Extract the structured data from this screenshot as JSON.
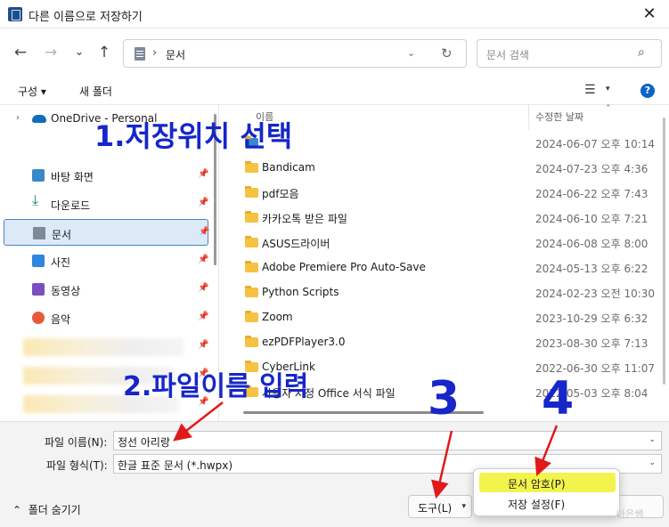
{
  "window": {
    "title": "다른 이름으로 저장하기",
    "close": "✕"
  },
  "nav": {
    "back": "←",
    "forward": "→",
    "recent": "⌄",
    "up": "↑",
    "address": "문서",
    "address_sep": "›",
    "address_dd": "⌄",
    "refresh": "↻",
    "search_placeholder": "문서 검색",
    "search_icon": "⌕"
  },
  "cmdbar": {
    "organize": "구성 ▾",
    "new_folder": "새 폴더",
    "view": "☰",
    "view_dd": "▾",
    "help": "?"
  },
  "sidebar": {
    "onedrive": "OneDrive - Personal",
    "items": [
      {
        "label": "바탕 화면",
        "icon": "desktop-icon"
      },
      {
        "label": "다운로드",
        "icon": "download-icon"
      },
      {
        "label": "문서",
        "icon": "document-icon"
      },
      {
        "label": "사진",
        "icon": "pictures-icon"
      },
      {
        "label": "동영상",
        "icon": "video-icon"
      },
      {
        "label": "음악",
        "icon": "music-icon"
      }
    ],
    "pin": "📌"
  },
  "list": {
    "col_name": "이름",
    "col_date": "수정한 날짜",
    "rows": [
      {
        "name": "",
        "date": "2024-06-07 오후 10:14"
      },
      {
        "name": "Bandicam",
        "date": "2024-07-23 오후 4:36"
      },
      {
        "name": "pdf모음",
        "date": "2024-06-22 오후 7:43"
      },
      {
        "name": "카카오톡 받은 파일",
        "date": "2024-06-10 오후 7:21"
      },
      {
        "name": "ASUS드라이버",
        "date": "2024-06-08 오후 8:00"
      },
      {
        "name": "Adobe Premiere Pro Auto-Save",
        "date": "2024-05-13 오후 6:22"
      },
      {
        "name": "Python Scripts",
        "date": "2024-02-23 오전 10:30"
      },
      {
        "name": "Zoom",
        "date": "2023-10-29 오후 6:32"
      },
      {
        "name": "ezPDFPlayer3.0",
        "date": "2023-08-30 오후 7:13"
      },
      {
        "name": "CyberLink",
        "date": "2022-06-30 오후 11:07"
      },
      {
        "name": "사용자 지정 Office 서식 파일",
        "date": "2022-05-03 오후 8:04"
      }
    ]
  },
  "form": {
    "filename_label": "파일 이름(N):",
    "filename_value": "정선 아리랑",
    "filetype_label": "파일 형식(T):",
    "filetype_value": "한글 표준 문서 (*.hwpx)",
    "hide_folders": "폴더 숨기기",
    "tools": "도구(L)"
  },
  "menu": {
    "item1": "문서 암호(P)",
    "item2": "저장 설정(F)"
  },
  "annotations": {
    "a1": "1.저장위치 선택",
    "a2": "2.파일이름 입력",
    "a3": "3",
    "a4": "4",
    "color": "#1626c8"
  },
  "colors": {
    "highlight": "#f3f34d",
    "arrow": "#e01a1a",
    "selection": "#dce9f7"
  }
}
